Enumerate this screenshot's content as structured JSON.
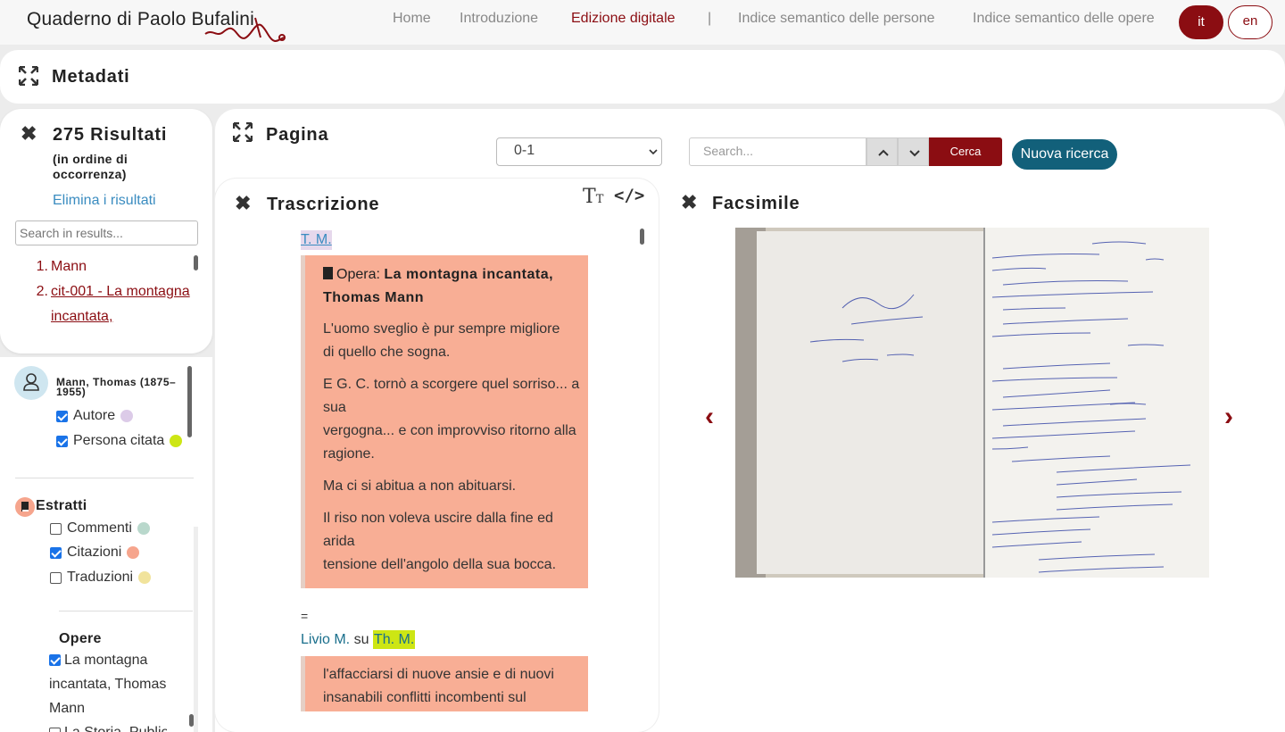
{
  "header": {
    "logo_text": "Quaderno di Paolo Bufalini",
    "nav": [
      "Home",
      "Introduzione",
      "Edizione digitale",
      "|",
      "Indice semantico delle persone",
      "Indice semantico delle opere"
    ],
    "active_nav": "Edizione digitale",
    "languages": [
      "it",
      "en"
    ],
    "active_language": "it"
  },
  "metadata": {
    "title": "Metadati"
  },
  "results": {
    "count_label": "275 Risultati",
    "subtitle": "(in ordine di occorrenza)",
    "clear_label": "Elimina i risultati",
    "search_placeholder": "Search in results...",
    "items": [
      {
        "num": "1.",
        "text": "Mann"
      },
      {
        "num": "2.",
        "text": "cit-001 - La montagna incantata,"
      }
    ]
  },
  "filters": {
    "person": {
      "name": "Mann, Thomas (1875–1955)",
      "options": [
        {
          "label": "Autore",
          "checked": true,
          "color": "#dccbe8"
        },
        {
          "label": "Persona citata",
          "checked": true,
          "color": "#cde614"
        }
      ]
    },
    "estratti": {
      "title": "Estratti",
      "options": [
        {
          "label": "Commenti",
          "checked": false,
          "color": "#b9d8cc"
        },
        {
          "label": "Citazioni",
          "checked": true,
          "color": "#f6a58d"
        },
        {
          "label": "Traduzioni",
          "checked": false,
          "color": "#f1e39c"
        }
      ]
    },
    "opere": {
      "title": "Opere",
      "options": [
        {
          "label": "La montagna incantata, Thomas Mann",
          "checked": true
        },
        {
          "label": "La Storia, Publio",
          "checked": false
        }
      ]
    }
  },
  "page": {
    "title": "Pagina",
    "page_select": "0-1",
    "search_placeholder": "Search...",
    "search_button": "Cerca",
    "new_search_button": "Nuova ricerca"
  },
  "transcription": {
    "title": "Trascrizione",
    "tm_label": "T. M.",
    "opera_prefix": "Opera:",
    "opera_title": "La montagna incantata, Thomas Mann",
    "quote1_lines": [
      "L'uomo sveglio è pur sempre migliore",
      "di quello che sogna.",
      "E G. C. tornò a scorgere quel sorriso... a",
      "sua",
      "vergogna... e con improvviso ritorno alla",
      "ragione.",
      "Ma ci si abitua a non abituarsi.",
      "Il riso non voleva uscire dalla fine ed",
      "arida",
      "tensione dell'angolo della sua bocca."
    ],
    "equals": "=",
    "livio_link": "Livio M.",
    "livio_mid": " su ",
    "livio_hl": "Th. M.",
    "quote2_lines": [
      "l'affacciarsi di nuove ansie e di nuovi",
      "insanabili conflitti incombenti sul"
    ]
  },
  "facsimile": {
    "title": "Facsimile"
  },
  "colors": {
    "accent": "#8b0d12",
    "teal": "#12607a",
    "quote_bg": "#f8ae95"
  }
}
